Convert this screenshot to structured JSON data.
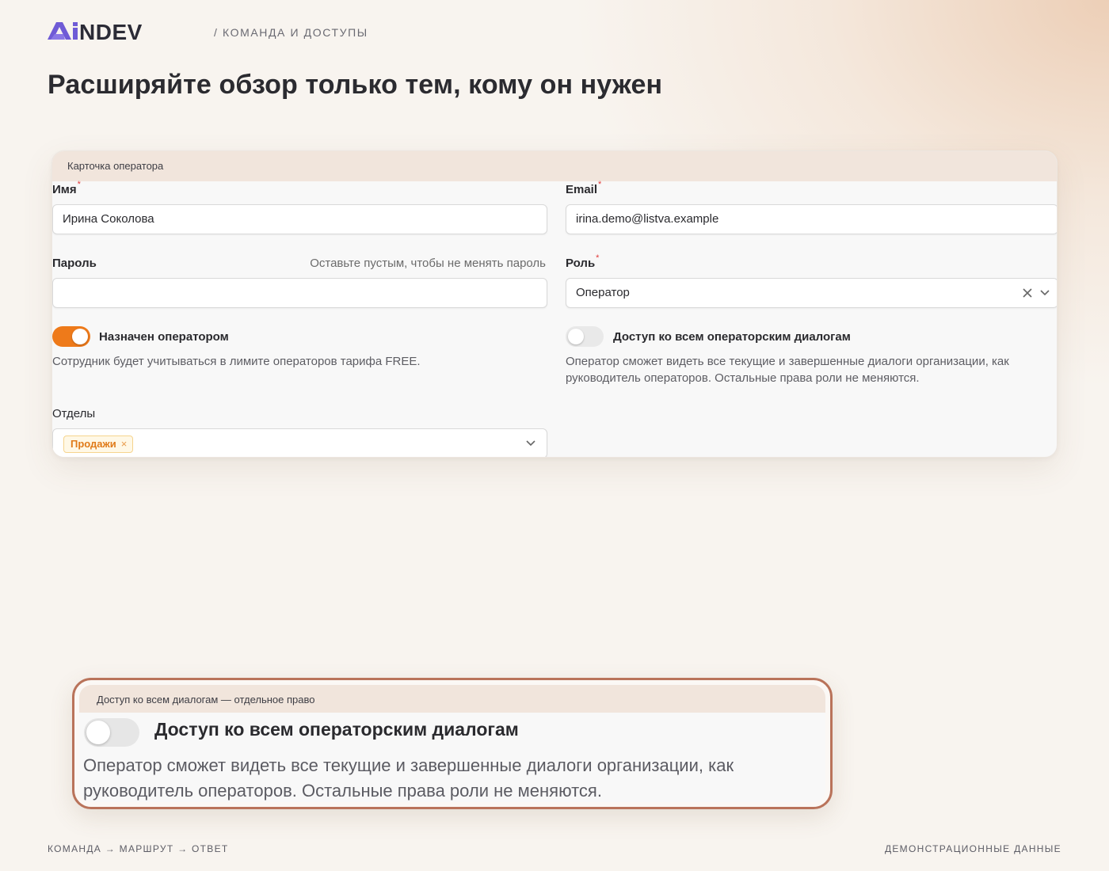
{
  "header": {
    "logo_text": "AiNDEV",
    "breadcrumb": "/ КОМАНДА И ДОСТУПЫ"
  },
  "page_title": "Расширяйте обзор только тем, кому он нужен",
  "card": {
    "title": "Карточка оператора",
    "name": {
      "label": "Имя",
      "required_mark": "*",
      "value": "Ирина Соколова"
    },
    "email": {
      "label": "Email",
      "required_mark": "*",
      "value": "irina.demo@listva.example"
    },
    "password": {
      "label": "Пароль",
      "hint": "Оставьте пустым, чтобы не менять пароль",
      "value": ""
    },
    "role": {
      "label": "Роль",
      "required_mark": "*",
      "value": "Оператор"
    },
    "assigned_operator": {
      "label": "Назначен оператором",
      "checked": true,
      "description": "Сотрудник будет учитываться в лимите операторов тарифа FREE."
    },
    "all_dialogs_access": {
      "label": "Доступ ко всем операторским диалогам",
      "checked": false,
      "description_line1": "Оператор сможет видеть все текущие и завершенные диалоги организации, как",
      "description_line2": "руководитель операторов. Остальные права роли не меняются."
    },
    "departments": {
      "label": "Отделы",
      "tags": [
        "Продажи"
      ],
      "tag_remove": "×"
    }
  },
  "zoom": {
    "title": "Доступ ко всем диалогам — отдельное право",
    "label": "Доступ ко всем операторским диалогам",
    "checked": false,
    "description_line1": "Оператор сможет видеть все текущие и завершенные диалоги организации, как",
    "description_line2": "руководитель операторов. Остальные права роли не меняются."
  },
  "footer": {
    "left": "КОМАНДА → МАРШРУТ → ОТВЕТ",
    "right": "ДЕМОНСТРАЦИОННЫЕ ДАННЫЕ"
  },
  "colors": {
    "accent": "#ee7a1a",
    "logo_purple": "#6f5bd6",
    "logo_dark": "#2b2b36",
    "required": "#e23b3b",
    "zoom_border": "#b9735a"
  },
  "icons": {
    "clear": "close-icon",
    "dropdown": "chevron-down-icon"
  }
}
